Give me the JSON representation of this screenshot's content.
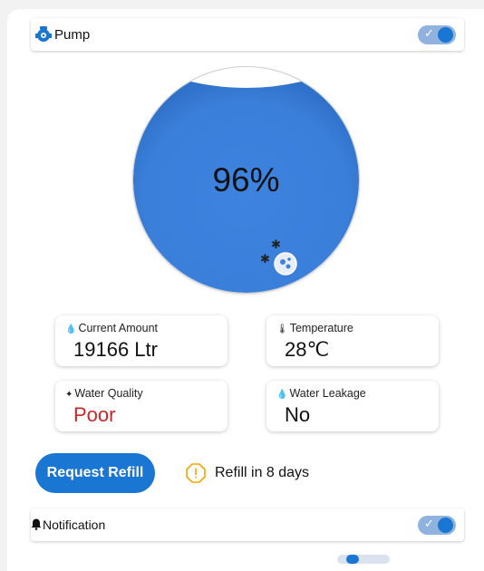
{
  "pump": {
    "label": "Pump",
    "icon": "pump-icon",
    "toggle_on": true
  },
  "tank": {
    "fill_percent": 96,
    "value_text": "96%",
    "color": "#3b80db"
  },
  "stats": {
    "current_amount": {
      "label": "Current Amount",
      "value": "19166 Ltr",
      "icon": "water-drop-icon"
    },
    "temperature": {
      "label": "Temperature",
      "value": "28℃",
      "icon": "thermometer-icon"
    },
    "water_quality": {
      "label": "Water Quality",
      "value": "Poor",
      "icon": "sparkle-icon"
    },
    "water_leakage": {
      "label": "Water Leakage",
      "value": "No",
      "icon": "drop-icon"
    }
  },
  "refill": {
    "button_label": "Request Refill",
    "status_text": "Refill in 8 days",
    "icon": "warning-icon"
  },
  "notification": {
    "label": "Notification",
    "icon": "bell-icon",
    "toggle_on": true
  },
  "colors": {
    "accent": "#1976d2",
    "warning": "#f0a500",
    "poor": "#c62828"
  }
}
